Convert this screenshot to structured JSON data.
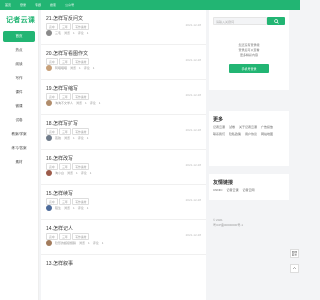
{
  "topbar": [
    "首页",
    "登录",
    "专题",
    "搜索",
    "公众号"
  ],
  "logo": "记者云课",
  "sidebar": [
    "首页",
    "热点",
    "阅读",
    "写作",
    "课件",
    "微课",
    "试卷",
    "教案/学案",
    "练习/答案",
    "素材"
  ],
  "posts": [
    {
      "title": "21.怎样写反问文",
      "tags": [
        "高中",
        "三年",
        "写作素材"
      ],
      "author": "三毛",
      "views": "1",
      "replies": "1",
      "date": "2021-12-28",
      "avatar": "#8a8a8a"
    },
    {
      "title": "20.怎样写看图作文",
      "tags": [
        "高中",
        "三年",
        "写作素材"
      ],
      "author": "阿哩哩哩",
      "views": "1",
      "replies": "1",
      "date": "2021-12-28",
      "avatar": "#c7a079"
    },
    {
      "title": "19.怎样写缩写",
      "tags": [
        "高中",
        "三年",
        "写作素材"
      ],
      "author": "淘淘不文学人",
      "views": "1",
      "replies": "1",
      "date": "2021-12-28",
      "avatar": "#b08c6b"
    },
    {
      "title": "18.怎样写扩写",
      "tags": [
        "高中",
        "三年",
        "写作素材"
      ],
      "author": "孤独",
      "views": "1",
      "replies": "1",
      "date": "2021-12-28",
      "avatar": "#6f7b8a"
    },
    {
      "title": "16.怎样改写",
      "tags": [
        "高中",
        "三年",
        "写作素材"
      ],
      "author": "淘小白",
      "views": "1",
      "replies": "1",
      "date": "2021-12-28",
      "avatar": "#9c5b4a"
    },
    {
      "title": "15.怎样续写",
      "tags": [
        "高中",
        "三年",
        "写作素材"
      ],
      "author": "陌生",
      "views": "1",
      "replies": "1",
      "date": "2021-12-28",
      "avatar": "#4d6b9a"
    },
    {
      "title": "14.怎样记人",
      "tags": [
        "高中",
        "三年",
        "写作素材"
      ],
      "author": "隐形的超级翅膀",
      "views": "1",
      "replies": "1",
      "date": "2021-12-28",
      "avatar": "#a27b5c"
    },
    {
      "title": "13.怎样叙事",
      "tags": [],
      "author": "",
      "views": "",
      "replies": "",
      "date": "",
      "avatar": "#ffffff"
    }
  ],
  "labels": {
    "views": "浏览",
    "replies": "评论"
  },
  "search": {
    "placeholder": "请输入关键词"
  },
  "login": {
    "line1": "您还没有登录哦",
    "line2": "登录后可以查看",
    "line3": "更多精彩内容",
    "button": "手机号登录"
  },
  "more": {
    "title": "更多",
    "links": [
      "记者云课",
      "试卷",
      "关于记者云课",
      "广告投放",
      "联系我们",
      "隐私政策",
      "用户协议",
      "网站地图"
    ]
  },
  "friends": {
    "title": "友情链接",
    "links": [
      "CNNIC",
      "记者云课",
      "记者云网"
    ]
  },
  "copyright": {
    "line1": "© 2021",
    "line2": "粤ICP备00000000号-1"
  },
  "colors": {
    "brand": "#22b573"
  }
}
